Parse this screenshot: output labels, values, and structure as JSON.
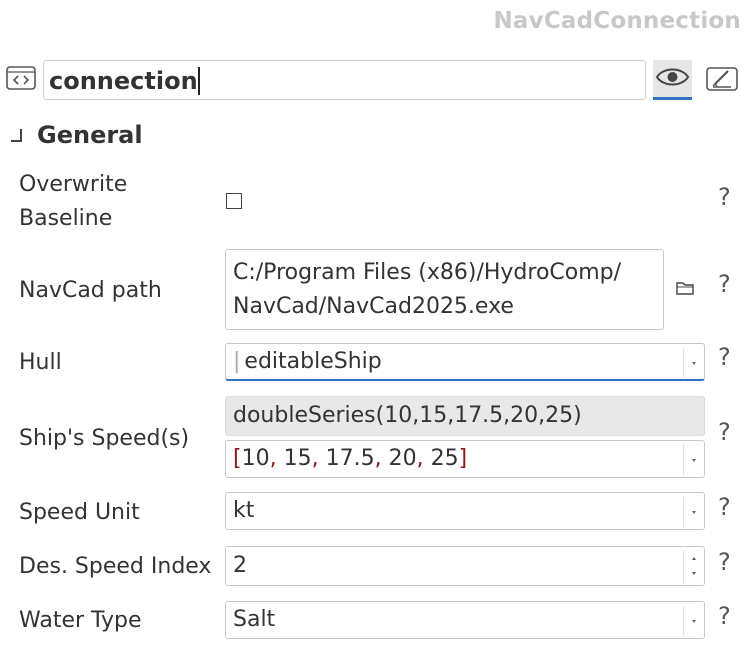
{
  "header": {
    "type_title": "NavCadConnection"
  },
  "name_field": {
    "value": "connection"
  },
  "icons": {
    "code": "code-brackets-icon",
    "eye": "eye-icon",
    "edit": "edit-pencil-icon",
    "collapse": "collapse-corner-icon",
    "folder": "folder-icon"
  },
  "section": {
    "title": "General"
  },
  "help_glyph": "?",
  "properties": {
    "overwrite_baseline": {
      "label_line1": "Overwrite",
      "label_line2": "Baseline",
      "checked": false
    },
    "navcad_path": {
      "label": "NavCad path",
      "line1": "C:/Program Files (x86)/HydroComp/",
      "line2": "NavCad/NavCad2025.exe"
    },
    "hull": {
      "label": "Hull",
      "value": "editableShip"
    },
    "ships_speeds": {
      "label": "Ship's Speed(s)",
      "expression": "doubleSeries(10,15,17.5,20,25)",
      "values": [
        "10",
        "15",
        "17.5",
        "20",
        "25"
      ]
    },
    "speed_unit": {
      "label": "Speed Unit",
      "value": "kt"
    },
    "des_speed_index": {
      "label": "Des. Speed Index",
      "value": "2"
    },
    "water_type": {
      "label": "Water Type",
      "value": "Salt"
    }
  },
  "colors": {
    "accent": "#2f73c0",
    "title_grey": "#c8c8c8",
    "bracket_red": "#8b1a1a"
  }
}
